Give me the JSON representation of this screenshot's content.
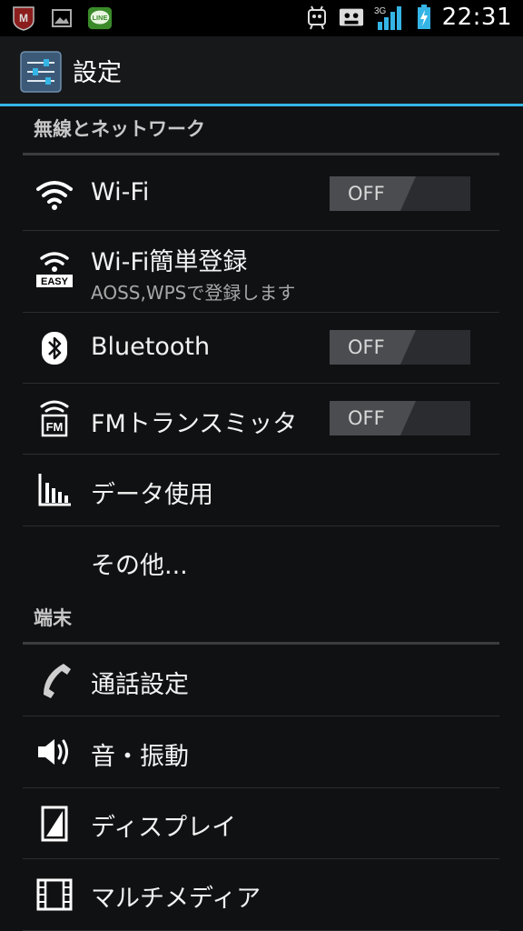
{
  "status_bar": {
    "time": "22:31",
    "network": "3G",
    "left_icons": [
      "mcafee-icon",
      "picture-icon",
      "line-icon"
    ],
    "right_icons": [
      "robot-icon",
      "cassette-icon",
      "signal-icon",
      "battery-icon"
    ]
  },
  "action_bar": {
    "title": "設定",
    "icon": "settings-sliders-icon"
  },
  "sections": [
    {
      "header": "無線とネットワーク"
    },
    {
      "header": "端末"
    }
  ],
  "items": {
    "wifi": {
      "title": "Wi-Fi",
      "toggle": "OFF",
      "icon": "wifi-icon"
    },
    "wifi_easy": {
      "title": "Wi-Fi簡単登録",
      "summary": "AOSS,WPSで登録します",
      "icon": "wifi-easy-icon",
      "badge": "EASY"
    },
    "bluetooth": {
      "title": "Bluetooth",
      "toggle": "OFF",
      "icon": "bluetooth-icon"
    },
    "fm": {
      "title": "FMトランスミッタ",
      "toggle": "OFF",
      "icon": "fm-transmitter-icon",
      "badge": "FM"
    },
    "data_usage": {
      "title": "データ使用",
      "icon": "bar-chart-icon"
    },
    "more": {
      "title": "その他..."
    },
    "call": {
      "title": "通話設定",
      "icon": "phone-icon"
    },
    "sound": {
      "title": "音・振動",
      "icon": "speaker-icon"
    },
    "display": {
      "title": "ディスプレイ",
      "icon": "display-icon"
    },
    "multimedia": {
      "title": "マルチメディア",
      "icon": "film-icon"
    }
  },
  "colors": {
    "accent": "#35b5e5",
    "background": "#101113"
  }
}
